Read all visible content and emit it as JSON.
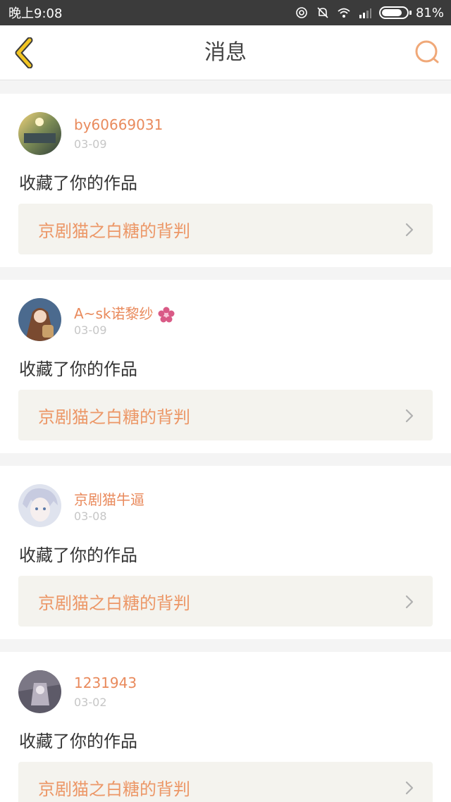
{
  "status_bar": {
    "time": "晚上9:08",
    "battery": "81%",
    "battery_level": 0.81
  },
  "header": {
    "title": "消息",
    "back_icon": "back-chevron-icon",
    "search_icon": "search-icon"
  },
  "colors": {
    "accent": "#e98a5c",
    "work_bg": "#f4f3ee",
    "back_icon": "#f2c522"
  },
  "messages": [
    {
      "user": "by60669031",
      "date": "03-09",
      "action": "收藏了你的作品",
      "work": "京剧猫之白糖的背判"
    },
    {
      "user": "A~sk诺黎纱",
      "date": "03-09",
      "action": "收藏了你的作品",
      "work": "京剧猫之白糖的背判"
    },
    {
      "user": "京剧猫牛逼",
      "date": "03-08",
      "action": "收藏了你的作品",
      "work": "京剧猫之白糖的背判"
    },
    {
      "user": "1231943",
      "date": "03-02",
      "action": "收藏了你的作品",
      "work": "京剧猫之白糖的背判"
    }
  ]
}
